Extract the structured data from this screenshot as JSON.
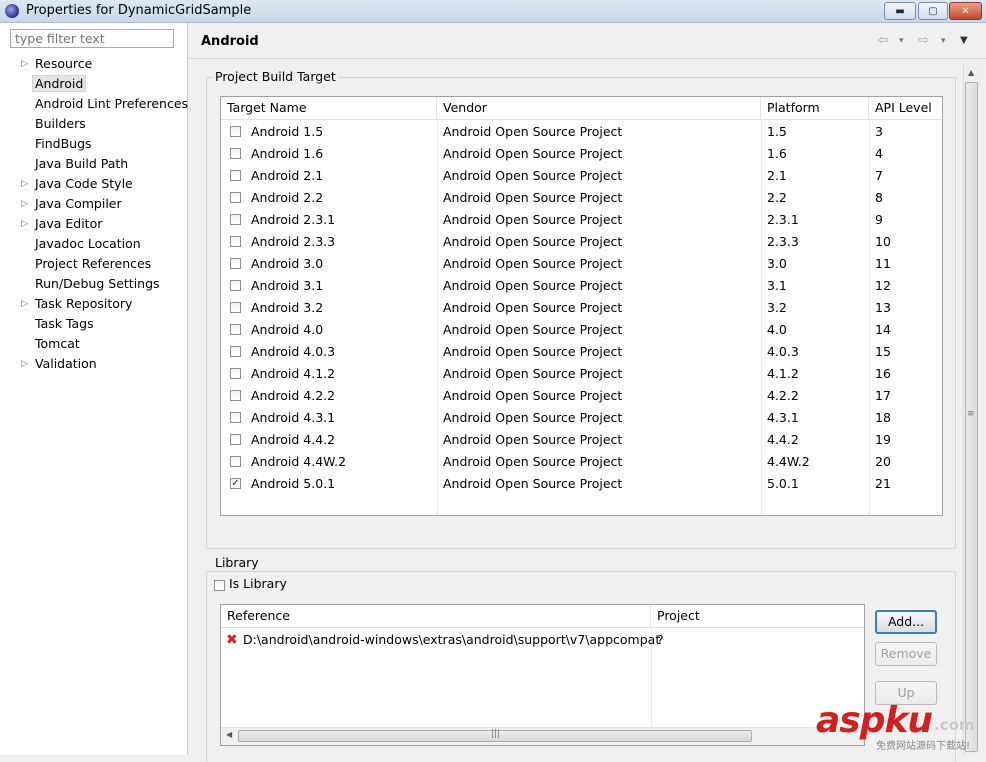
{
  "window": {
    "title": "Properties for DynamicGridSample",
    "minimize_glyph": "▬",
    "maximize_glyph": "▢",
    "close_glyph": "✕"
  },
  "sidebar": {
    "filter_placeholder": "type filter text",
    "items": [
      {
        "label": "Resource",
        "expandable": true
      },
      {
        "label": "Android",
        "expandable": false,
        "selected": true
      },
      {
        "label": "Android Lint Preferences",
        "expandable": false
      },
      {
        "label": "Builders",
        "expandable": false
      },
      {
        "label": "FindBugs",
        "expandable": false
      },
      {
        "label": "Java Build Path",
        "expandable": false
      },
      {
        "label": "Java Code Style",
        "expandable": true
      },
      {
        "label": "Java Compiler",
        "expandable": true
      },
      {
        "label": "Java Editor",
        "expandable": true
      },
      {
        "label": "Javadoc Location",
        "expandable": false
      },
      {
        "label": "Project References",
        "expandable": false
      },
      {
        "label": "Run/Debug Settings",
        "expandable": false
      },
      {
        "label": "Task Repository",
        "expandable": true
      },
      {
        "label": "Task Tags",
        "expandable": false
      },
      {
        "label": "Tomcat",
        "expandable": false
      },
      {
        "label": "Validation",
        "expandable": true
      }
    ]
  },
  "header": {
    "title": "Android",
    "back_glyph": "⇦",
    "forward_glyph": "⇨",
    "dropdown_glyph": "▾",
    "menu_glyph": "▼"
  },
  "build_target": {
    "group_label": "Project Build Target",
    "columns": [
      "Target Name",
      "Vendor",
      "Platform",
      "API Level"
    ],
    "rows": [
      {
        "name": "Android 1.5",
        "vendor": "Android Open Source Project",
        "platform": "1.5",
        "api": "3",
        "checked": false
      },
      {
        "name": "Android 1.6",
        "vendor": "Android Open Source Project",
        "platform": "1.6",
        "api": "4",
        "checked": false
      },
      {
        "name": "Android 2.1",
        "vendor": "Android Open Source Project",
        "platform": "2.1",
        "api": "7",
        "checked": false
      },
      {
        "name": "Android 2.2",
        "vendor": "Android Open Source Project",
        "platform": "2.2",
        "api": "8",
        "checked": false
      },
      {
        "name": "Android 2.3.1",
        "vendor": "Android Open Source Project",
        "platform": "2.3.1",
        "api": "9",
        "checked": false
      },
      {
        "name": "Android 2.3.3",
        "vendor": "Android Open Source Project",
        "platform": "2.3.3",
        "api": "10",
        "checked": false
      },
      {
        "name": "Android 3.0",
        "vendor": "Android Open Source Project",
        "platform": "3.0",
        "api": "11",
        "checked": false
      },
      {
        "name": "Android 3.1",
        "vendor": "Android Open Source Project",
        "platform": "3.1",
        "api": "12",
        "checked": false
      },
      {
        "name": "Android 3.2",
        "vendor": "Android Open Source Project",
        "platform": "3.2",
        "api": "13",
        "checked": false
      },
      {
        "name": "Android 4.0",
        "vendor": "Android Open Source Project",
        "platform": "4.0",
        "api": "14",
        "checked": false
      },
      {
        "name": "Android 4.0.3",
        "vendor": "Android Open Source Project",
        "platform": "4.0.3",
        "api": "15",
        "checked": false
      },
      {
        "name": "Android 4.1.2",
        "vendor": "Android Open Source Project",
        "platform": "4.1.2",
        "api": "16",
        "checked": false
      },
      {
        "name": "Android 4.2.2",
        "vendor": "Android Open Source Project",
        "platform": "4.2.2",
        "api": "17",
        "checked": false
      },
      {
        "name": "Android 4.3.1",
        "vendor": "Android Open Source Project",
        "platform": "4.3.1",
        "api": "18",
        "checked": false
      },
      {
        "name": "Android 4.4.2",
        "vendor": "Android Open Source Project",
        "platform": "4.4.2",
        "api": "19",
        "checked": false
      },
      {
        "name": "Android 4.4W.2",
        "vendor": "Android Open Source Project",
        "platform": "4.4W.2",
        "api": "20",
        "checked": false
      },
      {
        "name": "Android 5.0.1",
        "vendor": "Android Open Source Project",
        "platform": "5.0.1",
        "api": "21",
        "checked": true
      }
    ]
  },
  "library": {
    "group_label": "Library",
    "is_library_label": "Is Library",
    "is_library_checked": false,
    "columns": [
      "Reference",
      "Project"
    ],
    "rows": [
      {
        "reference": "D:\\android\\android-windows\\extras\\android\\support\\v7\\appcompat",
        "project": "?",
        "error": true
      }
    ],
    "buttons": {
      "add": "Add...",
      "remove": "Remove",
      "up": "Up"
    }
  },
  "watermark": {
    "brand": "aspku",
    "tld": ".com",
    "tagline": "免费网站源码下载站!"
  },
  "colors": {
    "error_icon": "#d92020",
    "watermark_red": "#d41f1f",
    "default_button_border": "#3c7fb1"
  }
}
